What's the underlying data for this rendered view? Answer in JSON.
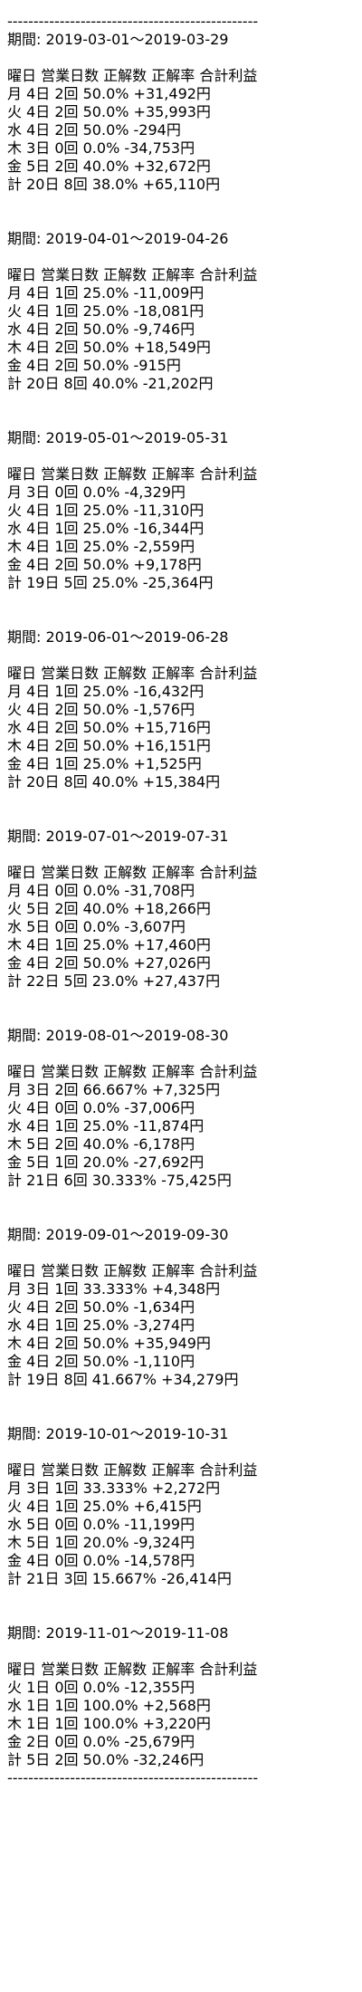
{
  "separator": "------------------------------------------------",
  "periods": [
    {
      "period": "期間: 2019-03-01～2019-03-29",
      "header": "曜日 営業日数 正解数 正解率 合計利益",
      "rows": [
        "月 4日 2回 50.0% +31,492円",
        "火 4日 2回 50.0% +35,993円",
        "水 4日 2回 50.0% -294円",
        "木 3日 0回 0.0% -34,753円",
        "金 5日 2回 40.0% +32,672円"
      ],
      "total": "計 20日 8回 38.0% +65,110円"
    },
    {
      "period": "期間: 2019-04-01～2019-04-26",
      "header": "曜日 営業日数 正解数 正解率 合計利益",
      "rows": [
        "月 4日 1回 25.0% -11,009円",
        "火 4日 1回 25.0% -18,081円",
        "水 4日 2回 50.0% -9,746円",
        "木 4日 2回 50.0% +18,549円",
        "金 4日 2回 50.0% -915円"
      ],
      "total": "計 20日 8回 40.0% -21,202円"
    },
    {
      "period": "期間: 2019-05-01～2019-05-31",
      "header": "曜日 営業日数 正解数 正解率 合計利益",
      "rows": [
        "月 3日 0回 0.0% -4,329円",
        "火 4日 1回 25.0% -11,310円",
        "水 4日 1回 25.0% -16,344円",
        "木 4日 1回 25.0% -2,559円",
        "金 4日 2回 50.0% +9,178円"
      ],
      "total": "計 19日 5回 25.0% -25,364円"
    },
    {
      "period": "期間: 2019-06-01～2019-06-28",
      "header": "曜日 営業日数 正解数 正解率 合計利益",
      "rows": [
        "月 4日 1回 25.0% -16,432円",
        "火 4日 2回 50.0% -1,576円",
        "水 4日 2回 50.0% +15,716円",
        "木 4日 2回 50.0% +16,151円",
        "金 4日 1回 25.0% +1,525円"
      ],
      "total": "計 20日 8回 40.0% +15,384円"
    },
    {
      "period": "期間: 2019-07-01～2019-07-31",
      "header": "曜日 営業日数 正解数 正解率 合計利益",
      "rows": [
        "月 4日 0回 0.0% -31,708円",
        "火 5日 2回 40.0% +18,266円",
        "水 5日 0回 0.0% -3,607円",
        "木 4日 1回 25.0% +17,460円",
        "金 4日 2回 50.0% +27,026円"
      ],
      "total": "計 22日 5回 23.0% +27,437円"
    },
    {
      "period": "期間: 2019-08-01～2019-08-30",
      "header": "曜日 営業日数 正解数 正解率 合計利益",
      "rows": [
        "月 3日 2回 66.667% +7,325円",
        "火 4日 0回 0.0% -37,006円",
        "水 4日 1回 25.0% -11,874円",
        "木 5日 2回 40.0% -6,178円",
        "金 5日 1回 20.0% -27,692円"
      ],
      "total": "計 21日 6回 30.333% -75,425円"
    },
    {
      "period": "期間: 2019-09-01～2019-09-30",
      "header": "曜日 営業日数 正解数 正解率 合計利益",
      "rows": [
        "月 3日 1回 33.333% +4,348円",
        "火 4日 2回 50.0% -1,634円",
        "水 4日 1回 25.0% -3,274円",
        "木 4日 2回 50.0% +35,949円",
        "金 4日 2回 50.0% -1,110円"
      ],
      "total": "計 19日 8回 41.667% +34,279円"
    },
    {
      "period": "期間: 2019-10-01～2019-10-31",
      "header": "曜日 営業日数 正解数 正解率 合計利益",
      "rows": [
        "月 3日 1回 33.333% +2,272円",
        "火 4日 1回 25.0% +6,415円",
        "水 5日 0回 0.0% -11,199円",
        "木 5日 1回 20.0% -9,324円",
        "金 4日 0回 0.0% -14,578円"
      ],
      "total": "計 21日 3回 15.667% -26,414円"
    },
    {
      "period": "期間: 2019-11-01～2019-11-08",
      "header": "曜日 営業日数 正解数 正解率 合計利益",
      "rows": [
        "火 1日 0回 0.0% -12,355円",
        "水 1日 1回 100.0% +2,568円",
        "木 1日 1回 100.0% +3,220円",
        "金 2日 0回 0.0% -25,679円"
      ],
      "total": "計 5日 2回 50.0% -32,246円"
    }
  ]
}
